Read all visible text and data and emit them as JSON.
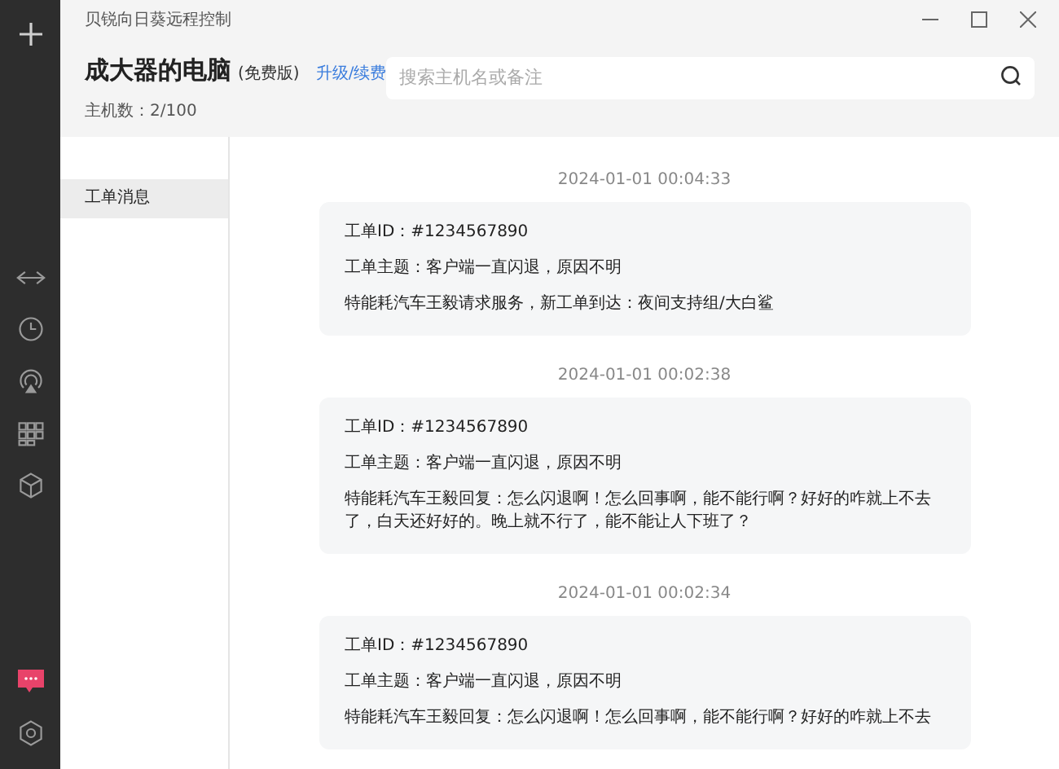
{
  "window": {
    "title": "贝锐向日葵远程控制"
  },
  "nav": [
    {
      "kind": "swap",
      "selected": false
    },
    {
      "kind": "clock",
      "selected": false
    },
    {
      "kind": "cast",
      "selected": false
    },
    {
      "kind": "grid",
      "selected": false
    },
    {
      "kind": "cube",
      "selected": false
    }
  ],
  "nav_bottom": [
    {
      "kind": "chat",
      "selected": true
    },
    {
      "kind": "settings",
      "selected": false
    }
  ],
  "header": {
    "name": "成大器的电脑",
    "edition": "(免费版)",
    "upgrade_link": "升级/续费",
    "host_count": "主机数：2/100"
  },
  "search": {
    "placeholder": "搜索主机名或备注"
  },
  "categories": [
    {
      "label": "工单消息",
      "selected": true
    }
  ],
  "messages": [
    {
      "time": "2024-01-01 00:04:33",
      "lines": [
        "工单ID：#1234567890",
        "工单主题：客户端一直闪退，原因不明",
        "特能耗汽车王毅请求服务，新工单到达：夜间支持组/大白鲨"
      ]
    },
    {
      "time": "2024-01-01 00:02:38",
      "lines": [
        "工单ID：#1234567890",
        "工单主题：客户端一直闪退，原因不明",
        "特能耗汽车王毅回复：怎么闪退啊！怎么回事啊，能不能行啊？好好的咋就上不去了，白天还好好的。晚上就不行了，能不能让人下班了？"
      ]
    },
    {
      "time": "2024-01-01 00:02:34",
      "lines": [
        "工单ID：#1234567890",
        "工单主题：客户端一直闪退，原因不明",
        "特能耗汽车王毅回复：怎么闪退啊！怎么回事啊，能不能行啊？好好的咋就上不去"
      ]
    }
  ]
}
